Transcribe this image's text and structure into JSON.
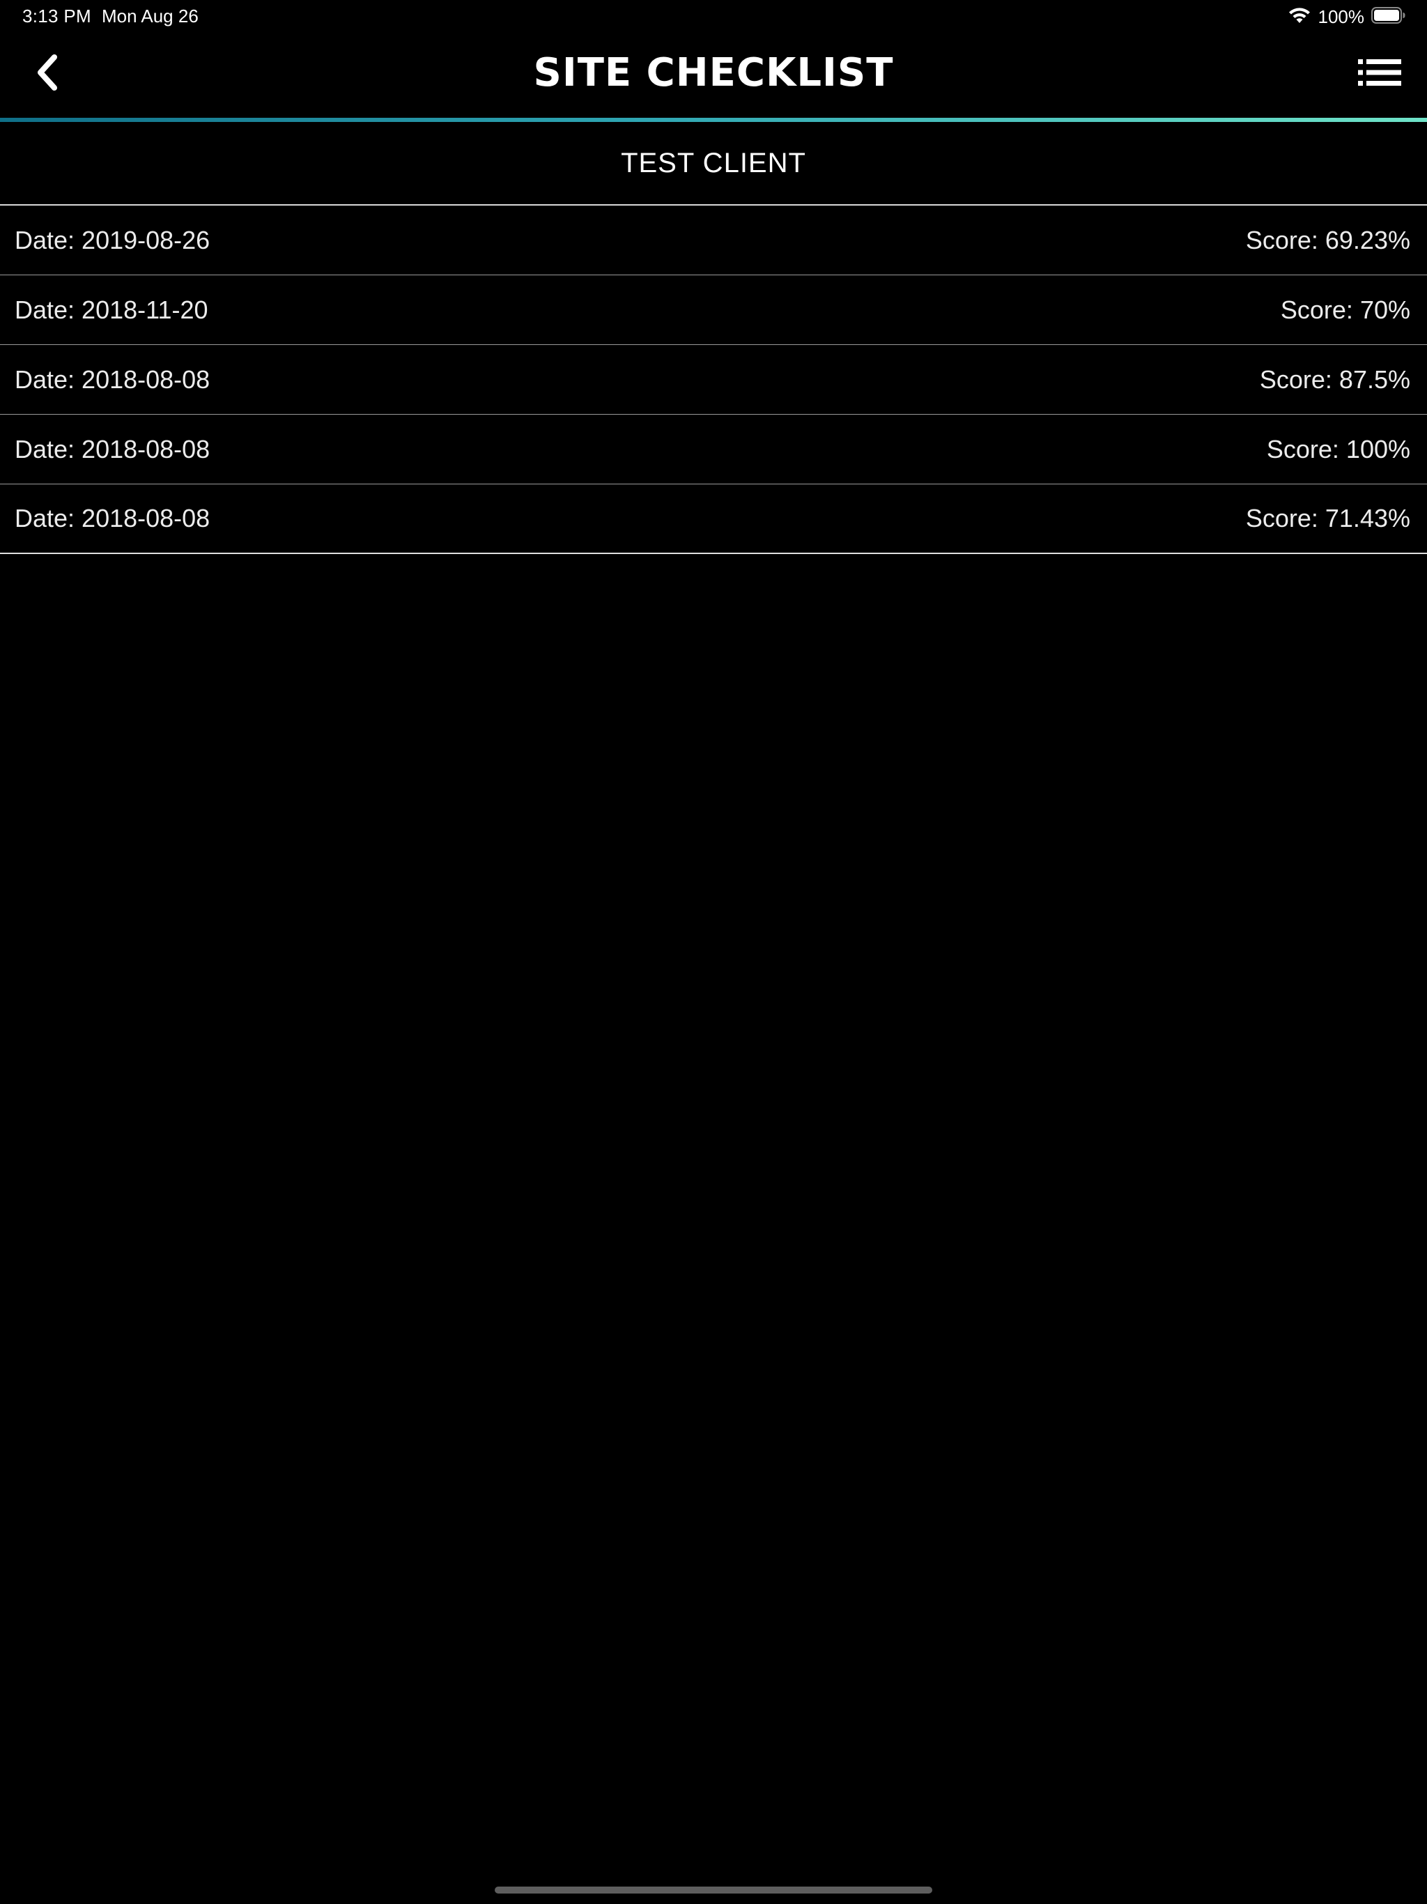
{
  "status_bar": {
    "time": "3:13 PM",
    "date": "Mon Aug 26",
    "battery": "100%"
  },
  "nav": {
    "title": "Site Checklist"
  },
  "client": {
    "name": "TEST CLIENT"
  },
  "records": [
    {
      "date": "Date: 2019-08-26",
      "score": "Score: 69.23%"
    },
    {
      "date": "Date: 2018-11-20",
      "score": "Score: 70%"
    },
    {
      "date": "Date: 2018-08-08",
      "score": "Score: 87.5%"
    },
    {
      "date": "Date: 2018-08-08",
      "score": "Score: 100%"
    },
    {
      "date": "Date: 2018-08-08",
      "score": "Score: 71.43%"
    }
  ],
  "colors": {
    "background": "#000000",
    "text": "#ffffff",
    "accent_start": "#0f6f88",
    "accent_end": "#6fe3c8"
  },
  "icons": {
    "back": "chevron-left-icon",
    "menu": "list-icon",
    "wifi": "wifi-icon",
    "battery": "battery-icon"
  }
}
